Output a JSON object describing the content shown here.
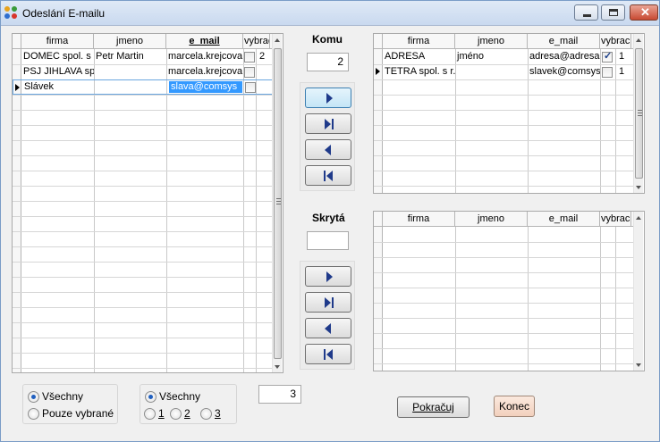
{
  "window": {
    "title": "Odeslání E-mailu"
  },
  "source_grid": {
    "columns": [
      "firma",
      "jmeno",
      "e_mail",
      "vybrac"
    ],
    "rows": [
      {
        "firma": "DOMEC spol. s r.",
        "jmeno": "Petr Martin",
        "e_mail": "marcela.krejcova",
        "vybran": false,
        "num": "2"
      },
      {
        "firma": "PSJ JIHLAVA sp",
        "jmeno": "",
        "e_mail": "marcela.krejcova",
        "vybran": false,
        "num": ""
      },
      {
        "firma": "Slávek",
        "jmeno": "",
        "e_mail": "slava@comsys",
        "vybran": false,
        "num": ""
      }
    ]
  },
  "komu": {
    "label": "Komu",
    "count": "2"
  },
  "komu_grid": {
    "columns": [
      "firma",
      "jmeno",
      "e_mail",
      "vybrac"
    ],
    "rows": [
      {
        "firma": "ADRESA",
        "jmeno": "jméno",
        "e_mail": "adresa@adresa",
        "vybran": true,
        "num": "1"
      },
      {
        "firma": "TETRA spol. s r.",
        "jmeno": "",
        "e_mail": "slavek@comsys",
        "vybran": false,
        "num": "1"
      }
    ]
  },
  "skryta": {
    "label": "Skrytá",
    "count": ""
  },
  "skryta_grid": {
    "columns": [
      "firma",
      "jmeno",
      "e_mail",
      "vybrac"
    ]
  },
  "filter_group": {
    "all": "Všechny",
    "selected_only": "Pouze vybrané"
  },
  "level_group": {
    "all": "Všechny",
    "opt1": "1",
    "opt2": "2",
    "opt3": "3"
  },
  "total_count": "3",
  "buttons": {
    "continue": "Pokračuj",
    "end": "Konec"
  },
  "colors": {
    "selection": "#3399ff",
    "arrow": "#1f3a8a"
  },
  "icons": {
    "move_right": "arrow-right-icon",
    "move_all_right": "arrow-right-end-icon",
    "move_left": "arrow-left-icon",
    "move_all_left": "arrow-left-end-icon"
  }
}
